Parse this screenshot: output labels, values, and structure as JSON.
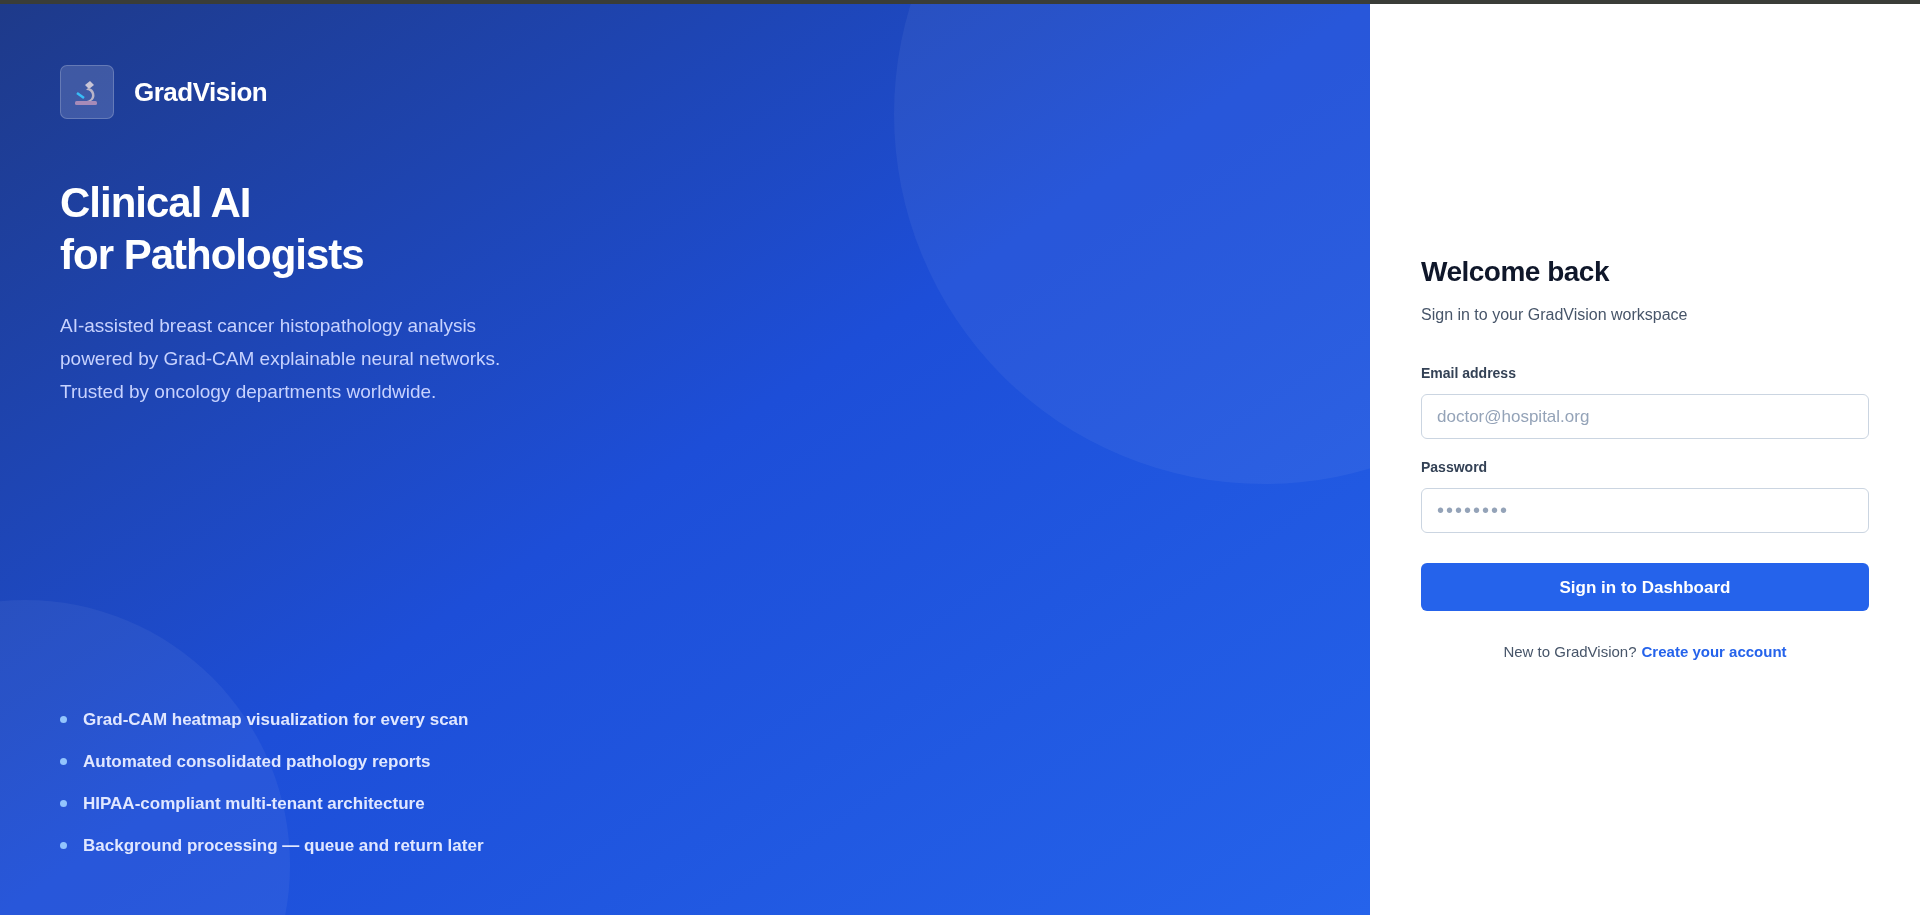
{
  "brand": {
    "name": "GradVision"
  },
  "hero": {
    "title_lines": [
      "Clinical AI",
      "for Pathologists"
    ],
    "description": [
      "AI-assisted breast cancer histopathology analysis",
      "powered by Grad-CAM explainable neural networks.",
      "Trusted by oncology departments worldwide."
    ]
  },
  "features": [
    "Grad-CAM heatmap visualization for every scan",
    "Automated consolidated pathology reports",
    "HIPAA-compliant multi-tenant architecture",
    "Background processing — queue and return later"
  ],
  "form": {
    "title": "Welcome back",
    "subtitle": "Sign in to your GradVision workspace",
    "fields": [
      {
        "label": "Email address",
        "placeholder": "doctor@hospital.org",
        "kind": "email"
      },
      {
        "label": "Password",
        "placeholder": "••••••••",
        "kind": "password"
      }
    ],
    "submit": "Sign in to Dashboard",
    "footer_text": "New to GradVision?",
    "footer_link": "Create your account"
  }
}
